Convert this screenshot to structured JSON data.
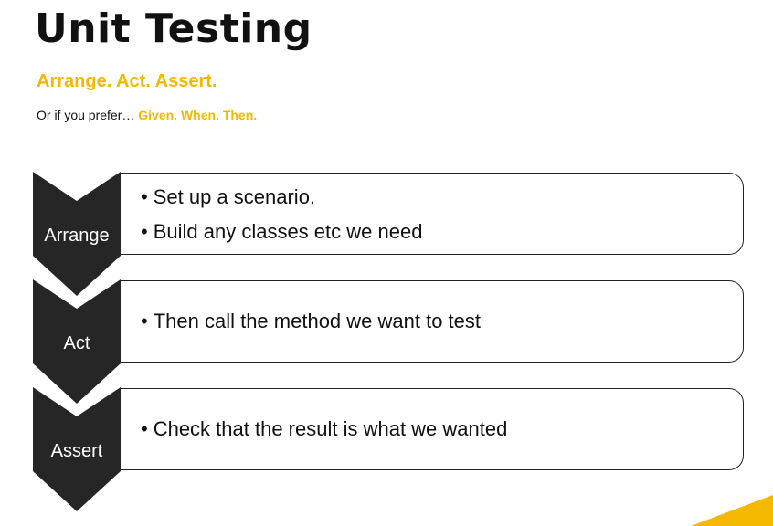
{
  "title": "Unit Testing",
  "subtitle": "Arrange. Act. Assert.",
  "alternative": {
    "prefix": "Or if you prefer… ",
    "emphasis": "Given. When. Then."
  },
  "steps": [
    {
      "label": "Arrange",
      "bullets": [
        "Set up a scenario.",
        "Build any classes etc we need"
      ]
    },
    {
      "label": "Act",
      "bullets": [
        "Then call the method we want to test"
      ]
    },
    {
      "label": "Assert",
      "bullets": [
        "Check that the result is what we wanted"
      ]
    }
  ],
  "colors": {
    "accent": "#f5b800",
    "chevron": "#262626",
    "text": "#111111"
  }
}
